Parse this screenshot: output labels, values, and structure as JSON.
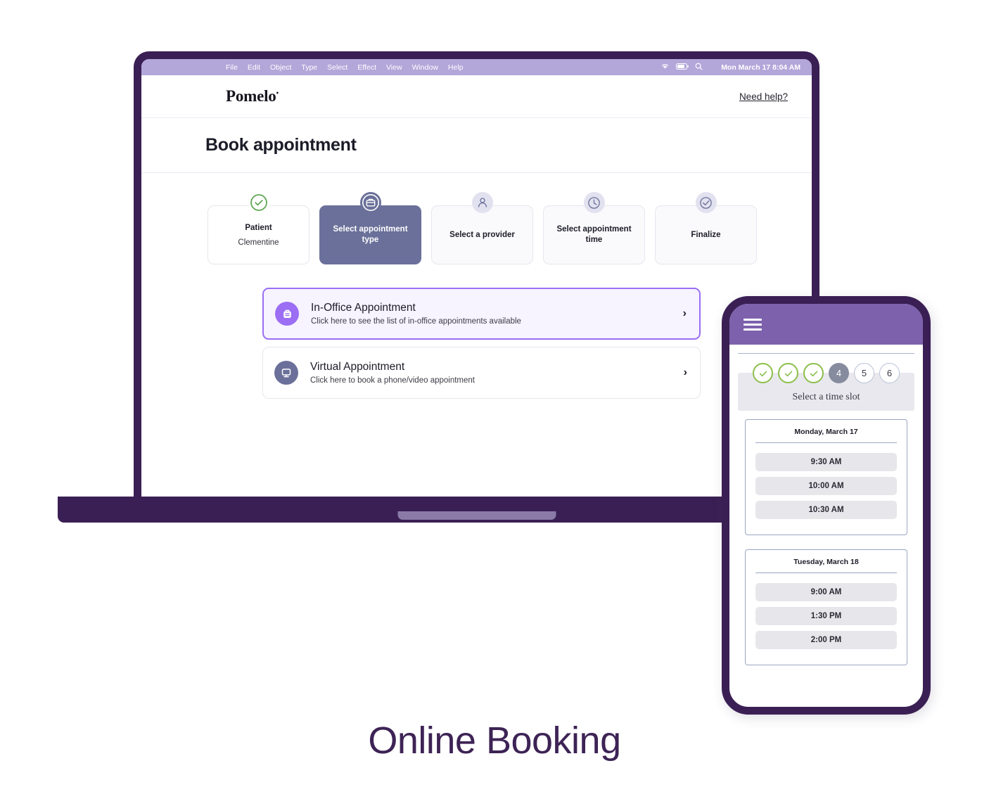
{
  "menubar": {
    "items": [
      "File",
      "Edit",
      "Object",
      "Type",
      "Select",
      "Effect",
      "View",
      "Window",
      "Help"
    ],
    "icons": [
      "wifi-icon",
      "battery-icon",
      "search-icon"
    ],
    "clock": "Mon March 17  8:04 AM",
    "background_color": "#b3a6d9"
  },
  "site_header": {
    "logo": "Pomelo",
    "logo_mark": "•",
    "help_link": "Need help?"
  },
  "page": {
    "title": "Book appointment"
  },
  "stepper": {
    "steps": [
      {
        "label": "Patient",
        "sub": "Clementine",
        "icon": "check-circle-icon",
        "state": "complete"
      },
      {
        "label": "Select appointment type",
        "sub": "",
        "icon": "briefcase-icon",
        "state": "active"
      },
      {
        "label": "Select a provider",
        "sub": "",
        "icon": "person-icon",
        "state": "upcoming"
      },
      {
        "label": "Select appointment time",
        "sub": "",
        "icon": "clock-icon",
        "state": "upcoming"
      },
      {
        "label": "Finalize",
        "sub": "",
        "icon": "check-badge-icon",
        "state": "upcoming"
      }
    ],
    "active_color": "#6a7099",
    "complete_color": "#5ba44f"
  },
  "options": [
    {
      "title": "In-Office Appointment",
      "subtitle": "Click here to see the list of in-office appointments available",
      "icon": "briefcase-icon",
      "chevron": "›",
      "selected": true,
      "accent_color": "#9b6ef3"
    },
    {
      "title": "Virtual Appointment",
      "subtitle": "Click here to book a phone/video appointment",
      "icon": "monitor-icon",
      "chevron": "›",
      "selected": false,
      "accent_color": "#6a7099"
    }
  ],
  "phone": {
    "topbar_color": "#7d61ad",
    "menu_icon": "hamburger-menu-icon",
    "steps": [
      {
        "label": "✓",
        "state": "done"
      },
      {
        "label": "✓",
        "state": "done"
      },
      {
        "label": "✓",
        "state": "done"
      },
      {
        "label": "4",
        "state": "current"
      },
      {
        "label": "5",
        "state": "todo"
      },
      {
        "label": "6",
        "state": "todo"
      }
    ],
    "step_label": "Select a time slot",
    "days": [
      {
        "heading": "Monday, March 17",
        "slots": [
          "9:30 AM",
          "10:00 AM",
          "10:30 AM"
        ]
      },
      {
        "heading": "Tuesday, March 18",
        "slots": [
          "9:00 AM",
          "1:30 PM",
          "2:00 PM"
        ]
      }
    ]
  },
  "caption": {
    "text": "Online Booking",
    "color": "#3d2355"
  }
}
